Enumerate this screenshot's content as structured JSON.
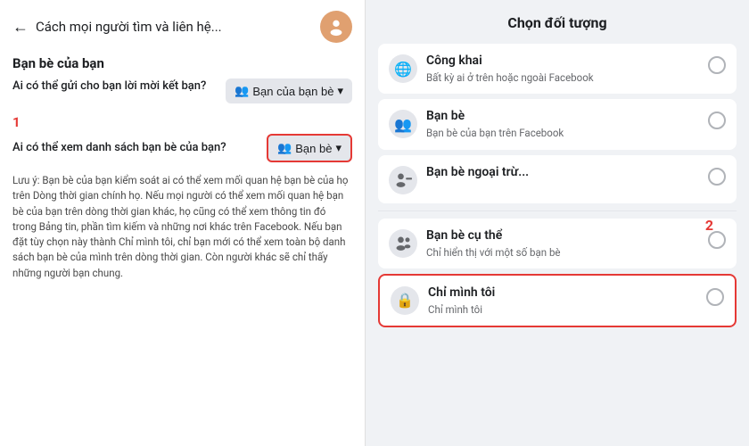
{
  "left": {
    "back_label": "←",
    "header_title": "Cách mọi người tìm và liên hệ...",
    "section_friends": "Bạn bè của bạn",
    "row1_label": "Ai có thể gửi cho bạn lời mời kết bạn?",
    "row1_btn": "Bạn của bạn bè",
    "row1_btn_icon": "👥",
    "row2_label": "Ai có thể xem danh sách bạn bè của bạn?",
    "row2_btn": "Bạn bè",
    "row2_btn_icon": "👥",
    "badge1": "1",
    "description": "Lưu ý: Bạn bè của bạn kiểm soát ai có thể xem mối quan hệ bạn bè của họ trên Dòng thời gian chính họ. Nếu mọi người có thể xem mối quan hệ bạn bè của bạn trên dòng thời gian khác, họ cũng có thể xem thông tin đó trong Bảng tin, phần tìm kiếm và những nơi khác trên Facebook. Nếu bạn đặt tùy chọn này thành Chỉ mình tôi, chỉ bạn mới có thể xem toàn bộ danh sách bạn bè của mình trên dòng thời gian. Còn người khác sẽ chỉ thấy những người bạn chung."
  },
  "right": {
    "panel_title": "Chọn đối tượng",
    "badge2": "2",
    "options": [
      {
        "id": "public",
        "icon": "🌐",
        "icon_type": "globe",
        "title": "Công khai",
        "desc": "Bất kỳ ai ở trên hoặc ngoài Facebook",
        "selected": false,
        "highlighted": false
      },
      {
        "id": "friends",
        "icon": "👥",
        "icon_type": "friends",
        "title": "Bạn bè",
        "desc": "Bạn bè của bạn trên Facebook",
        "selected": false,
        "highlighted": false
      },
      {
        "id": "friends-except",
        "icon": "👤",
        "icon_type": "friends-except",
        "title": "Bạn bè ngoại trừ...",
        "desc": "",
        "selected": false,
        "highlighted": false
      },
      {
        "id": "specific-friends",
        "icon": "👤",
        "icon_type": "specific",
        "title": "Bạn bè cụ thể",
        "desc": "Chỉ hiển thị với một số bạn bè",
        "selected": false,
        "highlighted": false
      },
      {
        "id": "only-me",
        "icon": "🔒",
        "icon_type": "lock",
        "title": "Chỉ mình tôi",
        "desc": "Chỉ mình tôi",
        "selected": false,
        "highlighted": true
      }
    ]
  }
}
